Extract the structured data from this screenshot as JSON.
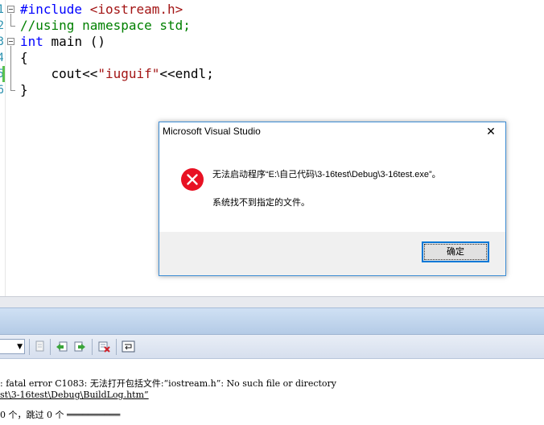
{
  "editor": {
    "lines": [
      {
        "num": "1",
        "parts": [
          {
            "t": "#include ",
            "c": "kw"
          },
          {
            "t": "<iostream.h>",
            "c": "str"
          }
        ]
      },
      {
        "num": "2",
        "parts": [
          {
            "t": "//using namespace std;",
            "c": "cm"
          }
        ]
      },
      {
        "num": "3",
        "parts": [
          {
            "t": "int",
            "c": "kw"
          },
          {
            "t": " main ()",
            "c": ""
          }
        ]
      },
      {
        "num": "4",
        "parts": [
          {
            "t": "{",
            "c": ""
          }
        ]
      },
      {
        "num": "5",
        "parts": [
          {
            "t": "    cout<<",
            "c": ""
          },
          {
            "t": "\"iuguif\"",
            "c": "str"
          },
          {
            "t": "<<endl;",
            "c": ""
          }
        ]
      },
      {
        "num": "6",
        "parts": [
          {
            "t": "}",
            "c": ""
          }
        ]
      }
    ]
  },
  "dialog": {
    "title": "Microsoft Visual Studio",
    "close_symbol": "✕",
    "icon": "error-icon",
    "message_line1": "无法启动程序“E:\\自己代码\\3-16test\\Debug\\3-16test.exe”。",
    "message_line2": "系统找不到指定的文件。",
    "ok_label": "确定"
  },
  "toolbar": {
    "combo_arrow": "▼",
    "icons": [
      "go-to-location-icon",
      "previous-message-icon",
      "next-message-icon",
      "clear-all-icon",
      "toggle-word-wrap-icon"
    ]
  },
  "output": {
    "line1": ": fatal error C1083: 无法打开包括文件:“iostream.h”: No such file or directory",
    "line2": "st\\3-16test\\Debug\\BuildLog.htm”",
    "line3": "0 个，跳过 0 个 ══════════"
  },
  "colors": {
    "keyword": "#0000ff",
    "string": "#a31515",
    "comment": "#008000",
    "line_number": "#2b91af",
    "dialog_border": "#3c8cd4",
    "error_red": "#e81123"
  }
}
